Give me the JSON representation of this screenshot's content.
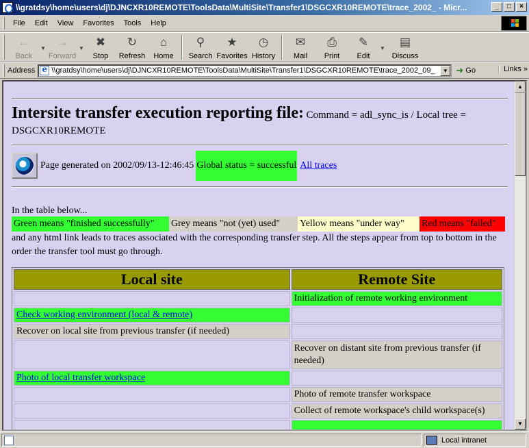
{
  "window": {
    "title": "\\\\gratdsy\\home\\users\\dj\\DJNCXR10REMOTE\\ToolsData\\MultiSite\\Transfer1\\DSGCXR10REMOTE\\trace_2002_ - Micr...",
    "min": "_",
    "max": "□",
    "close": "×"
  },
  "menu": {
    "file": "File",
    "edit": "Edit",
    "view": "View",
    "favorites": "Favorites",
    "tools": "Tools",
    "help": "Help"
  },
  "toolbar": {
    "back": "Back",
    "forward": "Forward",
    "stop": "Stop",
    "refresh": "Refresh",
    "home": "Home",
    "search": "Search",
    "favorites": "Favorites",
    "history": "History",
    "mail": "Mail",
    "print": "Print",
    "edit": "Edit",
    "discuss": "Discuss"
  },
  "address": {
    "label": "Address",
    "url": "\\\\gratdsy\\home\\users\\dj\\DJNCXR10REMOTE\\ToolsData\\MultiSite\\Transfer1\\DSGCXR10REMOTE\\trace_2002_09_",
    "go": "Go",
    "links": "Links"
  },
  "page": {
    "heading": "Intersite transfer execution reporting file:",
    "command": "Command = adl_sync_is / Local tree = DSGCXR10REMOTE",
    "generated": "Page generated on 2002/09/13-12:46:45",
    "global_status": "Global status = successful",
    "all_traces": "All traces",
    "intro": "In the table below...",
    "legend": {
      "green": "Green means \"finished successfully\"",
      "grey": "Grey means \"not (yet) used\"",
      "yellow": "Yellow means \"under way\"",
      "red": "Red means \"failed\""
    },
    "explanation": "and any html link leads to traces associated with the corresponding transfer step. All the steps appear from top to bottom in the order the transfer tool must go through.",
    "table": {
      "col_local": "Local site",
      "col_remote": "Remote Site",
      "rows": [
        {
          "local": "",
          "remote": "Initialization of remote working environment"
        },
        {
          "local": "Check working environment (local & remote)",
          "remote": ""
        },
        {
          "local": "Recover on local site from previous transfer (if needed)",
          "remote": ""
        },
        {
          "local": "",
          "remote": "Recover on distant site from previous transfer (if needed)"
        },
        {
          "local": "Photo of local transfer workspace",
          "remote": ""
        },
        {
          "local": "",
          "remote": "Photo of remote transfer workspace"
        },
        {
          "local": "",
          "remote": "Collect of remote workspace's child workspace(s)"
        }
      ]
    }
  },
  "statusbar": {
    "zone": "Local intranet"
  }
}
